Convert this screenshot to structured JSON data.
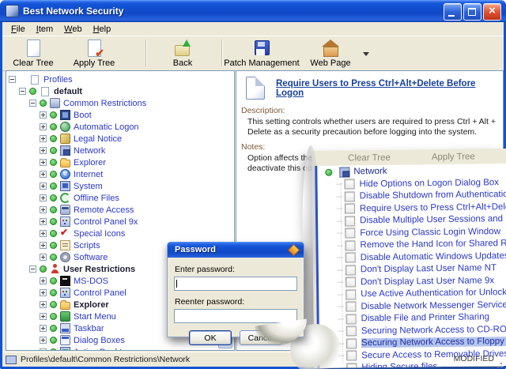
{
  "window": {
    "title": "Best Network Security"
  },
  "menu": {
    "items": [
      "File",
      "Item",
      "Web",
      "Help"
    ]
  },
  "toolbar": {
    "buttons": [
      {
        "label": "Clear Tree",
        "icon": "clear-tree-icon"
      },
      {
        "label": "Apply Tree",
        "icon": "apply-tree-icon"
      },
      {
        "label": "Back",
        "icon": "back-icon"
      },
      {
        "label": "Patch Management",
        "icon": "patch-management-icon"
      },
      {
        "label": "Web Page",
        "icon": "web-page-icon"
      }
    ]
  },
  "tree": {
    "items": [
      {
        "label": "Profiles",
        "level": 0,
        "expander": "minus",
        "dot": false,
        "icon": "page-icon",
        "bold": false
      },
      {
        "label": "default",
        "level": 1,
        "expander": "minus",
        "dot": true,
        "icon": "page-icon",
        "bold": true
      },
      {
        "label": "Common Restrictions",
        "level": 2,
        "expander": "minus",
        "dot": true,
        "icon": "server-icon",
        "bold": false
      },
      {
        "label": "Boot",
        "level": 3,
        "expander": "plus",
        "dot": true,
        "icon": "boot-icon",
        "bold": false
      },
      {
        "label": "Automatic Logon",
        "level": 3,
        "expander": "plus",
        "dot": true,
        "icon": "globe-icon",
        "bold": false
      },
      {
        "label": "Legal Notice",
        "level": 3,
        "expander": "plus",
        "dot": true,
        "icon": "legal-icon",
        "bold": false
      },
      {
        "label": "Network",
        "level": 3,
        "expander": "plus",
        "dot": true,
        "icon": "network-icon",
        "bold": false
      },
      {
        "label": "Explorer",
        "level": 3,
        "expander": "plus",
        "dot": true,
        "icon": "folder-icon",
        "bold": false
      },
      {
        "label": "Internet",
        "level": 3,
        "expander": "plus",
        "dot": true,
        "icon": "internet-icon",
        "bold": false
      },
      {
        "label": "System",
        "level": 3,
        "expander": "plus",
        "dot": true,
        "icon": "system-icon",
        "bold": false
      },
      {
        "label": "Offline Files",
        "level": 3,
        "expander": "plus",
        "dot": true,
        "icon": "offline-files-icon",
        "bold": false
      },
      {
        "label": "Remote Access",
        "level": 3,
        "expander": "plus",
        "dot": true,
        "icon": "remote-access-icon",
        "bold": false
      },
      {
        "label": "Control Panel 9x",
        "level": 3,
        "expander": "plus",
        "dot": true,
        "icon": "control-panel-icon",
        "bold": false
      },
      {
        "label": "Special Icons",
        "level": 3,
        "expander": "plus",
        "dot": true,
        "icon": "special-icons-icon",
        "bold": false
      },
      {
        "label": "Scripts",
        "level": 3,
        "expander": "plus",
        "dot": true,
        "icon": "scripts-icon",
        "bold": false
      },
      {
        "label": "Software",
        "level": 3,
        "expander": "plus",
        "dot": true,
        "icon": "software-icon",
        "bold": false
      },
      {
        "label": "User Restrictions",
        "level": 2,
        "expander": "minus",
        "dot": true,
        "icon": "user-icon",
        "bold": true
      },
      {
        "label": "MS-DOS",
        "level": 3,
        "expander": "plus",
        "dot": true,
        "icon": "msdos-icon",
        "bold": false
      },
      {
        "label": "Control Panel",
        "level": 3,
        "expander": "plus",
        "dot": true,
        "icon": "control-panel-icon",
        "bold": false
      },
      {
        "label": "Explorer",
        "level": 3,
        "expander": "plus",
        "dot": true,
        "icon": "folder-icon",
        "bold": true
      },
      {
        "label": "Start Menu",
        "level": 3,
        "expander": "plus",
        "dot": true,
        "icon": "start-menu-icon",
        "bold": false
      },
      {
        "label": "Taskbar",
        "level": 3,
        "expander": "plus",
        "dot": true,
        "icon": "taskbar-icon",
        "bold": false
      },
      {
        "label": "Dialog Boxes",
        "level": 3,
        "expander": "plus",
        "dot": true,
        "icon": "dialog-boxes-icon",
        "bold": false
      },
      {
        "label": "Active Desktop",
        "level": 3,
        "expander": "plus",
        "dot": true,
        "icon": "desktop-icon",
        "bold": false
      }
    ]
  },
  "detail": {
    "title": "Require Users to Press Ctrl+Alt+Delete Before Logon",
    "description_label": "Description:",
    "description": "This setting controls whether users are required to press Ctrl + Alt + Delete as a security precaution before logging into the system.",
    "notes_label": "Notes:",
    "notes": "Option affects the whole PC. Reboot your PC to activate or deactivate this option. Applicable to Windows 2000/XP."
  },
  "callout": {
    "toolbar_labels": [
      "Clear Tree",
      "Apply Tree"
    ],
    "parent_label": "Network",
    "parent_icon": "network-icon",
    "items": [
      {
        "label": "Hide Options on Logon Dialog Box",
        "selected": false
      },
      {
        "label": "Disable Shutdown from Authentication Dialog Box",
        "selected": false
      },
      {
        "label": "Require Users to Press Ctrl+Alt+Delete Before Logon",
        "selected": false
      },
      {
        "label": "Disable Multiple User Sessions and Fast User Switching",
        "selected": false
      },
      {
        "label": "Force Using Classic Login Window",
        "selected": false
      },
      {
        "label": "Remove the Hand Icon for Shared Resources",
        "selected": false
      },
      {
        "label": "Disable Automatic Windows Updates",
        "selected": false
      },
      {
        "label": "Don't Display Last User Name NT",
        "selected": false
      },
      {
        "label": "Don't Display Last User Name 9x",
        "selected": false
      },
      {
        "label": "Use Active Authentication for Unlock and Screensaver",
        "selected": false
      },
      {
        "label": "Disable Network Messenger Service",
        "selected": false
      },
      {
        "label": "Disable File and Printer Sharing",
        "selected": false
      },
      {
        "label": "Securing Network Access to CD-ROM Drives",
        "selected": false
      },
      {
        "label": "Securing Network Access to Floppy Drives",
        "selected": true
      },
      {
        "label": "Secure Access to Removable Drives",
        "selected": false
      },
      {
        "label": "Hiding Secure files",
        "selected": false
      }
    ]
  },
  "password_dialog": {
    "title": "Password",
    "enter_label": "Enter password:",
    "enter_value": "",
    "reenter_label": "Reenter password:",
    "reenter_value": "",
    "ok_label": "OK",
    "cancel_label": "Cancel"
  },
  "statusbar": {
    "path": "Profiles\\default\\Common Restrictions\\Network",
    "modified": "MODIFIED"
  },
  "colors": {
    "titlebar_blue": "#1353d0",
    "chrome_beige": "#ECE9D8",
    "tree_text_blue": "#2a38c8",
    "selection_blue": "#b4c4ee",
    "section_label_brown": "#7d5a35",
    "heading_navy": "#16409c",
    "enabled_dot_green": "#2fae2f"
  }
}
